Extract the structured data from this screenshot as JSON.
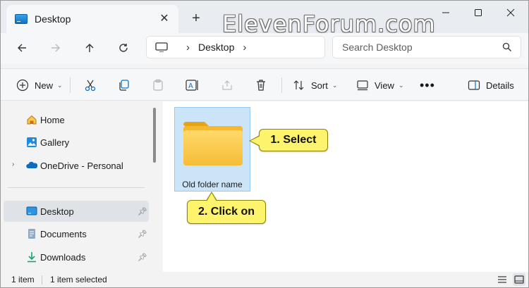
{
  "tab": {
    "title": "Desktop"
  },
  "watermark": "ElevenForum.com",
  "address": {
    "crumb": "Desktop"
  },
  "search": {
    "placeholder": "Search Desktop"
  },
  "commands": {
    "new_label": "New",
    "sort_label": "Sort",
    "view_label": "View",
    "details_label": "Details"
  },
  "sidebar": {
    "items": [
      {
        "label": "Home",
        "icon": "home-icon"
      },
      {
        "label": "Gallery",
        "icon": "gallery-icon"
      },
      {
        "label": "OneDrive - Personal",
        "icon": "onedrive-icon"
      },
      {
        "label": "Desktop",
        "icon": "desktop-icon",
        "selected": true,
        "pinned": true
      },
      {
        "label": "Documents",
        "icon": "documents-icon",
        "pinned": true
      },
      {
        "label": "Downloads",
        "icon": "downloads-icon",
        "pinned": true
      }
    ]
  },
  "content": {
    "items": [
      {
        "name": "Old folder name",
        "type": "folder",
        "selected": true
      }
    ]
  },
  "callouts": {
    "select": "1. Select",
    "click": "2. Click on"
  },
  "status": {
    "count": "1 item",
    "selected": "1 item selected"
  },
  "colors": {
    "selection": "#cce4f7",
    "callout": "#fdf36c",
    "accent": "#1172c4"
  }
}
